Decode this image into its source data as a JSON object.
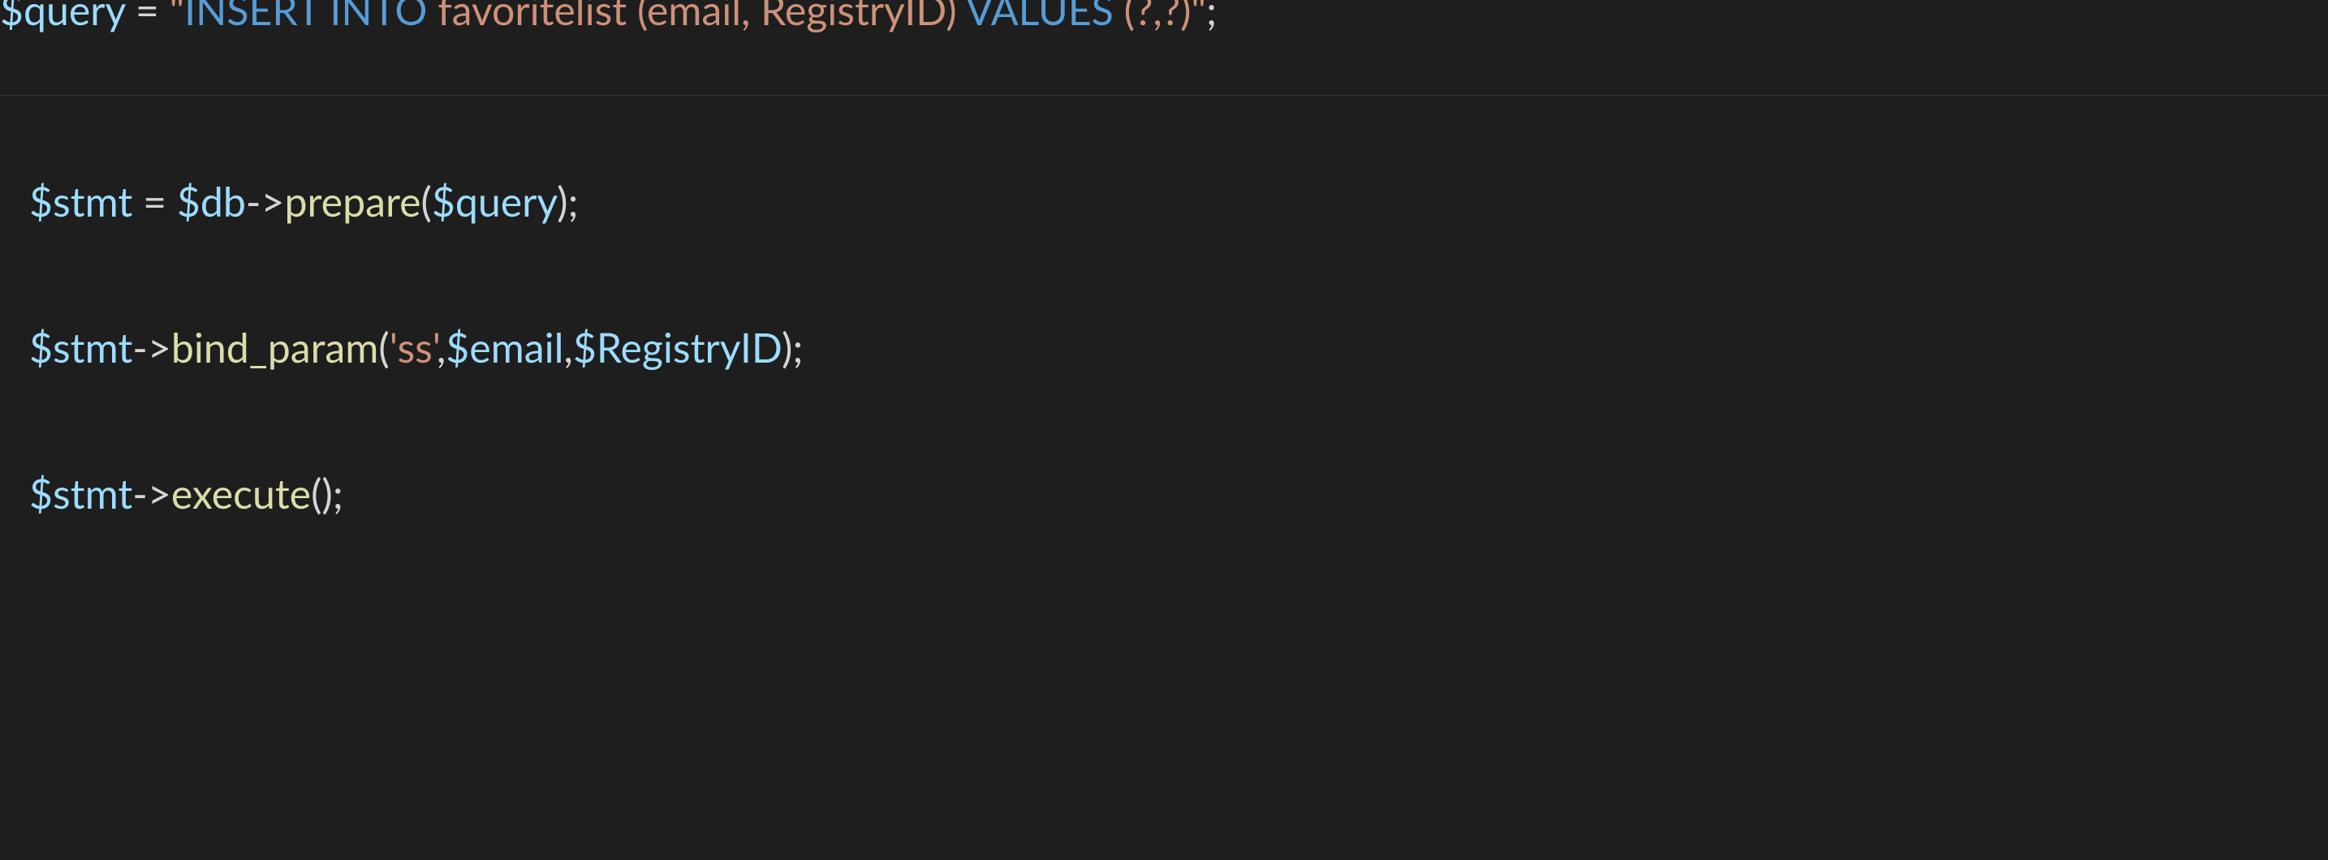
{
  "line1": {
    "var_query": "$query",
    "eq": " = ",
    "q1": "\"",
    "kw_insert_into": "INSERT INTO",
    "str_mid": " favoritelist (email, RegistryID) ",
    "kw_values": "VALUES",
    "str_tail": " (?,?)",
    "q2": "\"",
    "semi": ";"
  },
  "line2": {
    "var_stmt": "$stmt",
    "eq": " = ",
    "var_db": "$db",
    "arrow": "->",
    "fn_prepare": "prepare",
    "lp": "(",
    "var_query": "$query",
    "rp": ")",
    "semi": ";"
  },
  "line3": {
    "var_stmt": "$stmt",
    "arrow": "->",
    "fn_bind": "bind_param",
    "lp": "(",
    "str_ss": "'ss'",
    "comma1": ",",
    "var_email": "$email",
    "comma2": ",",
    "var_reg": "$RegistryID",
    "rp": ")",
    "semi": ";"
  },
  "line4": {
    "var_stmt": "$stmt",
    "arrow": "->",
    "fn_execute": "execute",
    "lp": "(",
    "rp": ")",
    "semi": ";"
  }
}
